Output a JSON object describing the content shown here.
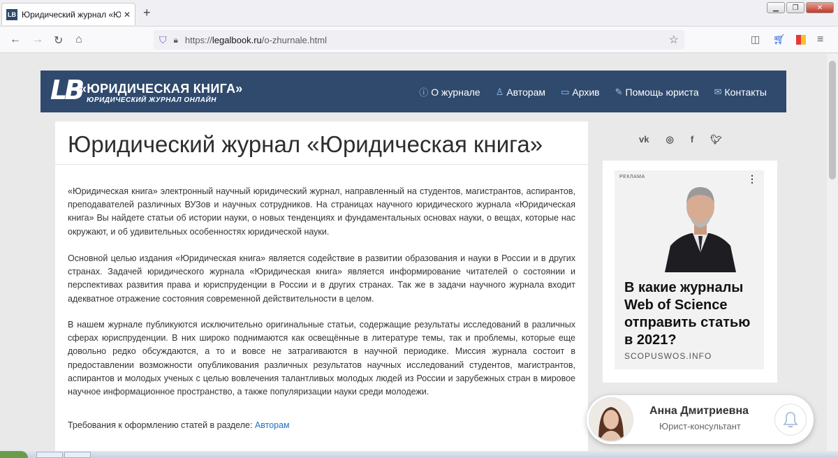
{
  "browser": {
    "tab_title": "Юридический журнал «Юридическая книга»",
    "url_domain": "legalbook.ru",
    "url_path": "/o-zhurnale.html",
    "url_scheme": "https://"
  },
  "site": {
    "logo_mark": "LB",
    "logo_title": "«ЮРИДИЧЕСКАЯ КНИГА»",
    "logo_subtitle": "ЮРИДИЧЕСКИЙ ЖУРНАЛ ОНЛАЙН",
    "menu": [
      {
        "label": "О журнале",
        "icon": "info-icon"
      },
      {
        "label": "Авторам",
        "icon": "user-icon"
      },
      {
        "label": "Архив",
        "icon": "folder-icon"
      },
      {
        "label": "Помощь юриста",
        "icon": "pencil-icon"
      },
      {
        "label": "Контакты",
        "icon": "mail-icon"
      }
    ]
  },
  "article": {
    "title": "Юридический журнал «Юридическая книга»",
    "p1": " «Юридическая книга» электронный научный юридический журнал, направленный на студентов, магистрантов, аспирантов, преподавателей различных ВУЗов и научных сотрудников. На страницах научного юридического журнала «Юридическая книга» Вы найдете статьи об истории науки, о новых тенденциях и фундаментальных основах науки, о вещах, которые нас окружают, и об удивительных особенностях юридической науки.",
    "p2": "  Основной целью издания «Юридическая книга» является содействие в развитии образования и науки в России и в других странах. Задачей юридического журнала «Юридическая книга» является информирование читателей о состоянии и перспективах развития права и юриспруденции в России и в других странах. Так же в задачи научного журнала входит адекватное отражение состояния современной действительности в целом.",
    "p3": "  В нашем журнале публикуются исключительно оригинальные статьи, содержащие результаты исследований в различных сферах юриспруденции. В них широко поднимаются как освещённые в литературе темы, так и проблемы, которые еще довольно редко обсуждаются, а то и вовсе не затрагиваются в научной периодике. Миссия журнала состоит в предоставлении возможности опубликования различных результатов научных исследований студентов, магистрантов, аспирантов и молодых ученых с целью вовлечения талантливых молодых людей из России и зарубежных стран в мировое научное информационное пространство, а также популяризации науки среди молодежи.",
    "p4_text": "Требования к оформлению статей в разделе: ",
    "p4_link": "Авторам"
  },
  "social": [
    "vk",
    "instagram",
    "facebook",
    "twitter"
  ],
  "ad": {
    "label": "РЕКЛАМА",
    "headline": "В какие журналы Web of Science отправить статью в 2021?",
    "domain": "SCOPUSWOS.INFO"
  },
  "chat": {
    "name": "Анна Дмитриевна",
    "role": "Юрист-консультант"
  }
}
